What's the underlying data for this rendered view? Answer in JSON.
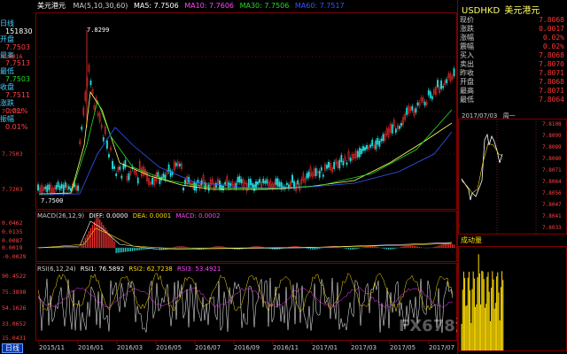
{
  "title_bar": {
    "symbol": "美元港元",
    "ma_label": "MA(5,10,30,60)",
    "ma5": "MA5: 7.7506",
    "ma10": "MA10: 7.7606",
    "ma30": "MA30: 7.7506",
    "ma60": "MA60: 7.7517"
  },
  "left_panel": {
    "items": [
      {
        "label": "日线",
        "value": "151830",
        "cls": "w"
      },
      {
        "label": "开盘",
        "value": "7.7503",
        "cls": ""
      },
      {
        "label": "最高",
        "value": "7.7513",
        "cls": ""
      },
      {
        "label": "最低",
        "value": "7.7503",
        "cls": "g"
      },
      {
        "label": "收盘",
        "value": "7.7511",
        "cls": ""
      },
      {
        "label": "涨跌",
        "value": "0.01%",
        "cls": ""
      },
      {
        "label": "振幅",
        "value": "0.01%",
        "cls": ""
      }
    ]
  },
  "main_chart": {
    "peak_label": "7.8299",
    "low_label": "7.7500",
    "y_ticks": [
      "7.8016",
      "7.7712",
      "7.7503",
      "7.7203"
    ]
  },
  "macd": {
    "label": "MACD(26,12,9)",
    "diff": "DIFF: 0.0000",
    "dea": "DEA: 0.0001",
    "macd": "MACD: 0.0002",
    "y_ticks": [
      "0.0462",
      "0.0135",
      "0.0087",
      "0.0019",
      "-0.0029"
    ]
  },
  "rsi": {
    "label": "RSI(6,12,24)",
    "rsi1": "RSI1: 76.5892",
    "rsi2": "RSI2: 62.7238",
    "rsi3": "RSI3: 53.4921",
    "y_ticks": [
      "90.4522",
      "75.3898",
      "54.1626",
      "33.0652",
      "15.0431"
    ]
  },
  "x_axis": {
    "period_tab": "日线",
    "labels": [
      "2015/11",
      "2016/01",
      "2016/03",
      "2016/05",
      "2016/07",
      "2016/09",
      "2016/11",
      "2017/01",
      "2017/03",
      "2017/05",
      "2017/07"
    ]
  },
  "right_panel": {
    "code": "USDHKD",
    "name": "美元港元",
    "quote_rows": [
      {
        "k": "现价",
        "v": "7.8068"
      },
      {
        "k": "涨跌",
        "v": "0.0017"
      },
      {
        "k": "涨幅",
        "v": "0.02%"
      },
      {
        "k": "震幅",
        "v": "0.02%"
      },
      {
        "k": "买入",
        "v": "7.8068"
      },
      {
        "k": "卖出",
        "v": "7.8070"
      },
      {
        "k": "昨收",
        "v": "7.8071"
      },
      {
        "k": "开盘",
        "v": "7.8068"
      },
      {
        "k": "最高",
        "v": "7.8071"
      },
      {
        "k": "最低",
        "v": "7.8064"
      }
    ],
    "intraday_date": "2017/07/03",
    "intraday_weekday": "周一",
    "intraday_y_ticks": [
      "7.8108",
      "7.8099",
      "7.8089",
      "7.8080",
      "7.8071",
      "7.8064",
      "7.8056",
      "7.8047",
      "7.8041",
      "7.8033"
    ],
    "volume_label": "成动量"
  },
  "watermark": "FX678汇通网"
}
